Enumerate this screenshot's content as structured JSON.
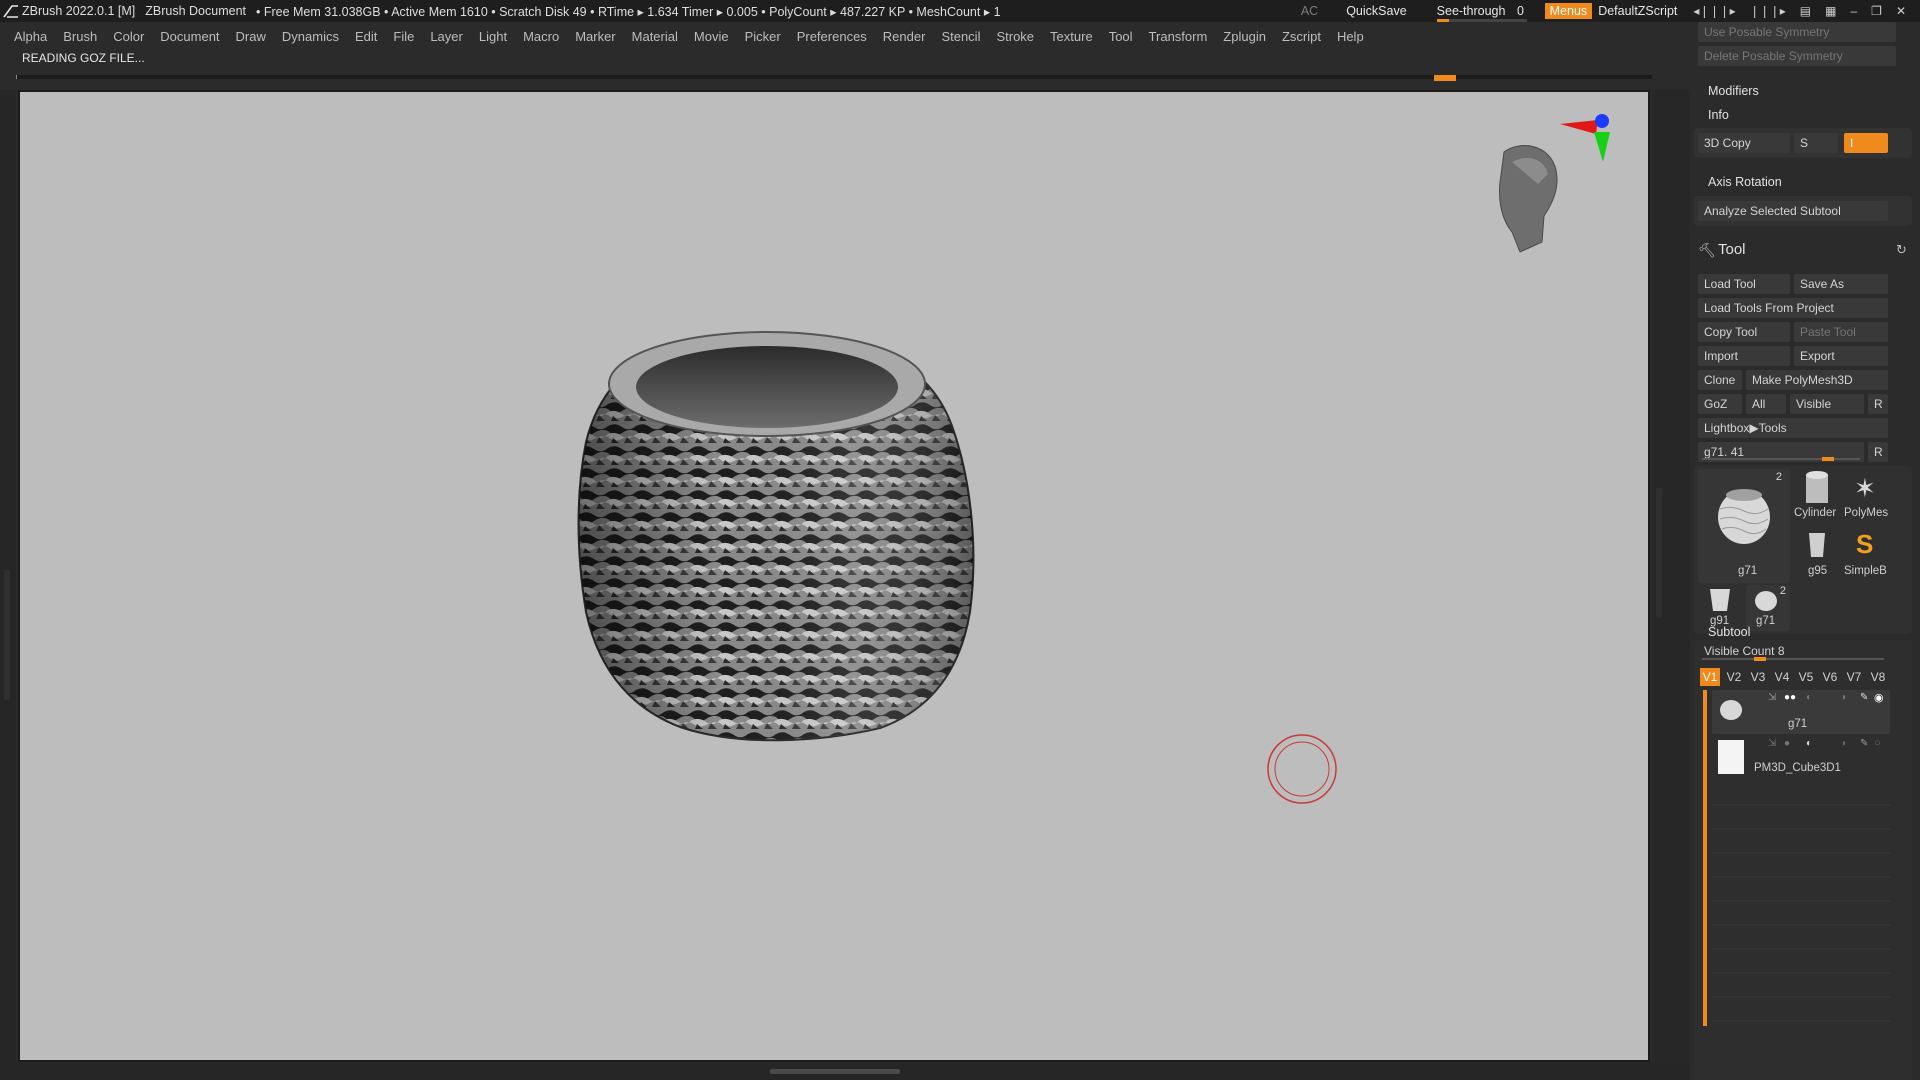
{
  "titlebar": {
    "app_title": "ZBrush 2022.0.1 [M]",
    "document": "ZBrush Document",
    "stats": "• Free Mem 31.038GB • Active Mem 1610 • Scratch Disk 49 •  RTime ▸ 1.634 Timer ▸ 0.005 • PolyCount ▸ 487.227 KP  • MeshCount ▸ 1",
    "ac": "AC",
    "quicksave": "QuickSave",
    "seethrough_label": "See-through",
    "seethrough_value": "0",
    "seethrough_fraction": 0,
    "menus": "Menus",
    "default_zscript": "DefaultZScript",
    "colors": {
      "accent": "#f08a1c"
    }
  },
  "menubar": {
    "items": [
      "Alpha",
      "Brush",
      "Color",
      "Document",
      "Draw",
      "Dynamics",
      "Edit",
      "File",
      "Layer",
      "Light",
      "Macro",
      "Marker",
      "Material",
      "Movie",
      "Picker",
      "Preferences",
      "Render",
      "Stencil",
      "Stroke",
      "Texture",
      "Tool",
      "Transform",
      "Zplugin",
      "Zscript",
      "Help"
    ]
  },
  "status": {
    "message": "READING GOZ FILE..."
  },
  "viewport": {
    "model_name": "g71"
  },
  "panel": {
    "top_buttons": [
      "Use Posable Symmetry",
      "Delete Posable Symmetry"
    ],
    "modifiers": "Modifiers",
    "info": "Info",
    "copy3d": {
      "label": "3D Copy",
      "s": "S",
      "i": "I"
    },
    "axis_rotation": "Axis Rotation",
    "analyze": "Analyze Selected Subtool",
    "tool": {
      "title": "Tool",
      "load_tool": "Load Tool",
      "save_as": "Save As",
      "load_from_project": "Load Tools From Project",
      "copy_tool": "Copy Tool",
      "paste_tool": "Paste Tool",
      "import": "Import",
      "export": "Export",
      "clone": "Clone",
      "make_polymesh": "Make PolyMesh3D",
      "goz": "GoZ",
      "all": "All",
      "visible": "Visible",
      "r": "R",
      "lightbox": "Lightbox▶Tools",
      "slider_label": "g71. 41",
      "slider_r": "R",
      "thumbs": [
        {
          "name": "g71",
          "badge": "2"
        },
        {
          "name": "Cylinder"
        },
        {
          "name": "PolyMes"
        },
        {
          "name": "g95"
        },
        {
          "name": "SimpleB"
        },
        {
          "name": "g91"
        },
        {
          "name": "g71",
          "badge": "2"
        }
      ]
    },
    "subtool": {
      "title": "Subtool",
      "visible_count": "Visible Count 8",
      "visible_count_fraction": 0.38,
      "tabs": [
        "V1",
        "V2",
        "V3",
        "V4",
        "V5",
        "V6",
        "V7",
        "V8"
      ],
      "active_tab": "V1",
      "items": [
        {
          "name": "g71"
        },
        {
          "name": "PM3D_Cube3D1"
        }
      ]
    }
  }
}
